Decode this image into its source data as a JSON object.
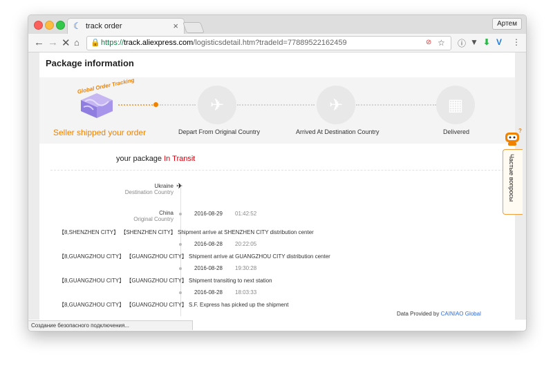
{
  "browser": {
    "tab_title": "track order",
    "user_button": "Артем",
    "url": {
      "scheme": "https://",
      "host": "track.aliexpress.com",
      "rest": "/logisticsdetail.htm?tradeId=77889522162459"
    },
    "status_bar": "Создание безопасного подключения...",
    "icons": {
      "back": "arrow-left",
      "forward": "arrow-right",
      "stop": "close-x",
      "home": "home",
      "lock": "lock",
      "bookmark": "star"
    }
  },
  "page": {
    "title": "Package information",
    "progress": {
      "globe_label": "Global Order Tracking",
      "steps": [
        {
          "label": "Seller shipped your order"
        },
        {
          "label": "Depart From Original Country"
        },
        {
          "label": "Arrived At Destination Country"
        },
        {
          "label": "Delivered"
        }
      ]
    },
    "status": {
      "prefix": "your package",
      "value": "In Transit"
    },
    "destination": {
      "name": "Ukraine",
      "label": "Destination Country"
    },
    "origin": {
      "name": "China",
      "label": "Original Country"
    },
    "events": [
      {
        "date": "2016-08-29",
        "time": "01:42:52",
        "text": "【8,SHENZHEN CITY】 【SHENZHEN CITY】 Shipment arrive at SHENZHEN CITY distribution center"
      },
      {
        "date": "2016-08-28",
        "time": "20:22:05",
        "text": "【8,GUANGZHOU CITY】 【GUANGZHOU CITY】 Shipment arrive at GUANGZHOU CITY distribution center"
      },
      {
        "date": "2016-08-28",
        "time": "19:30:28",
        "text": "【8,GUANGZHOU CITY】 【GUANGZHOU CITY】 Shipment transiting to next station"
      },
      {
        "date": "2016-08-28",
        "time": "18:03:33",
        "text": "【8,GUANGZHOU CITY】 【GUANGZHOU CITY】 S.F. Express has picked up the shipment"
      }
    ],
    "provider": {
      "prefix": "Data Provided by",
      "name": "CAINIAO Global"
    },
    "faq": {
      "label": "Частые вопросы"
    }
  },
  "colors": {
    "accent": "#f08200",
    "status": "#d9000d",
    "link": "#2b6ad6"
  }
}
